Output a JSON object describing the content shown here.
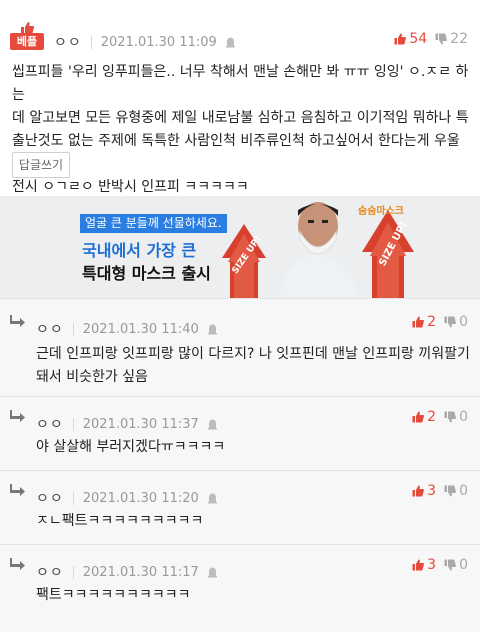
{
  "best_comment": {
    "badge": "베플",
    "author": "ㅇㅇ",
    "timestamp": "2021.01.30 11:09",
    "upvotes": "54",
    "downvotes": "22",
    "lines": [
      "씹프피들 '우리 잉푸피들은.. 너무 착해서 맨날 손해만 봐 ㅠㅠ 잉잉' ㅇ.ㅈㄹ 하는",
      "데 알고보면 모든 유형중에 제일 내로남불 심하고 음침하고 이기적임 뭐하나 특",
      "출난것도 없는 주제에 독특한 사람인척 비주류인척 하고싶어서 한다는게 우울증",
      "전시 ㅇㄱㄹㅇ 반박시 인프피 ㅋㅋㅋㅋㅋ"
    ],
    "reply_button": "답글쓰기"
  },
  "ad": {
    "tag": "얼굴 큰 분들께 선물하세요.",
    "line1": "국내에서 가장 큰",
    "line2": "특대형 마스크 출시",
    "logo": "숨숨마스크",
    "arrow_text": "SIZE UP!"
  },
  "replies": [
    {
      "author": "ㅇㅇ",
      "timestamp": "2021.01.30 11:40",
      "upvotes": "2",
      "downvotes": "0",
      "lines": [
        "근데 인프피랑 잇프피랑 많이 다르지? 나 잇프핀데 맨날 인프피랑 끼워팔기",
        "돼서 비슷한가 싶음"
      ]
    },
    {
      "author": "ㅇㅇ",
      "timestamp": "2021.01.30 11:37",
      "upvotes": "2",
      "downvotes": "0",
      "lines": [
        "야 살살해 부러지겠다ㅠㅋㅋㅋㅋ"
      ]
    },
    {
      "author": "ㅇㅇ",
      "timestamp": "2021.01.30 11:20",
      "upvotes": "3",
      "downvotes": "0",
      "lines": [
        "ㅈㄴ팩트ㅋㅋㅋㅋㅋㅋㅋㅋㅋ"
      ]
    },
    {
      "author": "ㅇㅇ",
      "timestamp": "2021.01.30 11:17",
      "upvotes": "3",
      "downvotes": "0",
      "lines": [
        "팩트ㅋㅋㅋㅋㅋㅋㅋㅋㅋㅋ"
      ]
    }
  ],
  "colors": {
    "accent": "#e64a3c",
    "muted": "#999999",
    "ad_blue": "#2a7de1"
  }
}
